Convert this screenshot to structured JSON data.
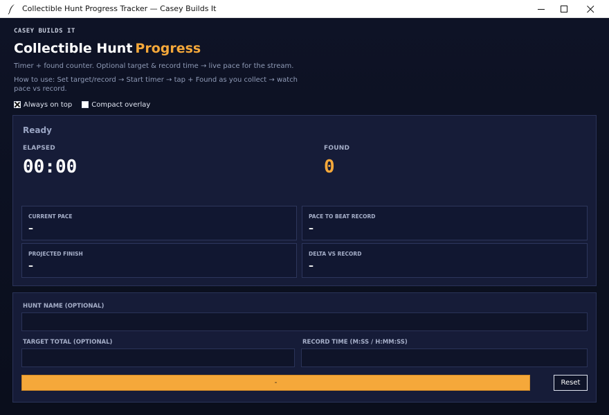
{
  "window": {
    "title": "Collectible Hunt Progress Tracker — Casey Builds It",
    "icon": "feather-icon"
  },
  "header": {
    "brand": "CASEY BUILDS IT",
    "title_main": "Collectible Hunt",
    "title_accent": "Progress",
    "subtitle": "Timer + found counter. Optional target & record time → live pace for the stream.",
    "howto": "How to use: Set target/record → Start timer → tap + Found as you collect → watch pace vs record."
  },
  "options": {
    "always_on_top": {
      "label": "Always on top",
      "checked": true
    },
    "compact_overlay": {
      "label": "Compact overlay",
      "checked": false
    }
  },
  "stats": {
    "status": "Ready",
    "elapsed_label": "ELAPSED",
    "elapsed_value": "00:00",
    "found_label": "FOUND",
    "found_value": "0",
    "cards": [
      {
        "label": "CURRENT PACE",
        "value": "–"
      },
      {
        "label": "PACE TO BEAT RECORD",
        "value": "–"
      },
      {
        "label": "PROJECTED FINISH",
        "value": "–"
      },
      {
        "label": "DELTA VS RECORD",
        "value": "–"
      }
    ]
  },
  "form": {
    "hunt_name_label": "HUNT NAME (OPTIONAL)",
    "hunt_name_value": "",
    "target_label": "TARGET TOTAL (OPTIONAL)",
    "target_value": "",
    "record_label": "RECORD TIME (M:SS / H:MM:SS)",
    "record_value": "",
    "primary_button": "-",
    "reset_button": "Reset"
  },
  "colors": {
    "accent": "#f5a83a",
    "background": "#0c1020",
    "panel": "#161c38"
  }
}
